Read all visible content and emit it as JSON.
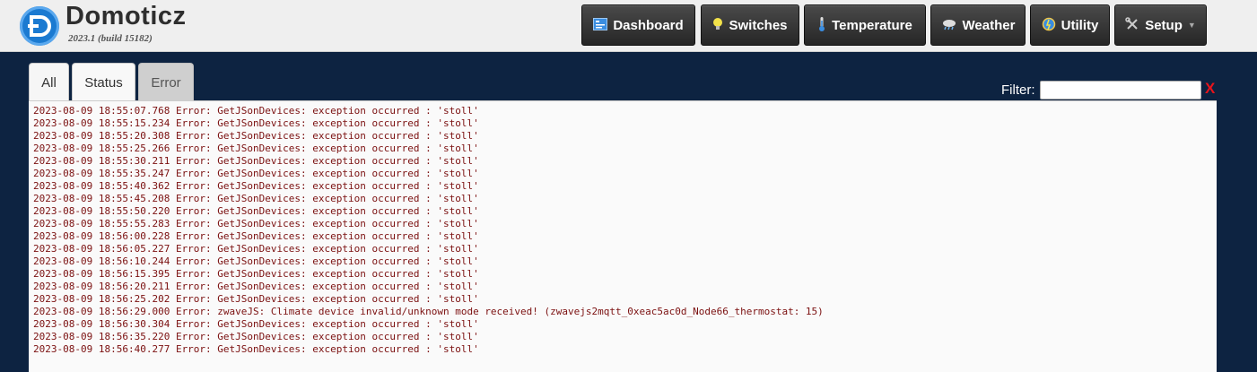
{
  "header": {
    "brand": "Domoticz",
    "version": "2023.1 (build 15182)"
  },
  "nav": [
    {
      "label": "Dashboard",
      "icon": "dashboard-icon"
    },
    {
      "label": "Switches",
      "icon": "lightbulb-icon"
    },
    {
      "label": "Temperature",
      "icon": "thermometer-icon"
    },
    {
      "label": "Weather",
      "icon": "weather-icon"
    },
    {
      "label": "Utility",
      "icon": "utility-icon"
    },
    {
      "label": "Setup",
      "icon": "tools-icon",
      "dropdown": true
    }
  ],
  "tabs": [
    {
      "label": "All"
    },
    {
      "label": "Status"
    },
    {
      "label": "Error"
    }
  ],
  "filter": {
    "label": "Filter:",
    "value": "",
    "clear": "X"
  },
  "colors": {
    "background": "#0d2341",
    "log_text": "#7b1010",
    "clear_icon": "#e8141b"
  },
  "log_lines": [
    "2023-08-09 18:55:07.768 Error: GetJSonDevices: exception occurred : 'stoll'",
    "2023-08-09 18:55:15.234 Error: GetJSonDevices: exception occurred : 'stoll'",
    "2023-08-09 18:55:20.308 Error: GetJSonDevices: exception occurred : 'stoll'",
    "2023-08-09 18:55:25.266 Error: GetJSonDevices: exception occurred : 'stoll'",
    "2023-08-09 18:55:30.211 Error: GetJSonDevices: exception occurred : 'stoll'",
    "2023-08-09 18:55:35.247 Error: GetJSonDevices: exception occurred : 'stoll'",
    "2023-08-09 18:55:40.362 Error: GetJSonDevices: exception occurred : 'stoll'",
    "2023-08-09 18:55:45.208 Error: GetJSonDevices: exception occurred : 'stoll'",
    "2023-08-09 18:55:50.220 Error: GetJSonDevices: exception occurred : 'stoll'",
    "2023-08-09 18:55:55.283 Error: GetJSonDevices: exception occurred : 'stoll'",
    "2023-08-09 18:56:00.228 Error: GetJSonDevices: exception occurred : 'stoll'",
    "2023-08-09 18:56:05.227 Error: GetJSonDevices: exception occurred : 'stoll'",
    "2023-08-09 18:56:10.244 Error: GetJSonDevices: exception occurred : 'stoll'",
    "2023-08-09 18:56:15.395 Error: GetJSonDevices: exception occurred : 'stoll'",
    "2023-08-09 18:56:20.211 Error: GetJSonDevices: exception occurred : 'stoll'",
    "2023-08-09 18:56:25.202 Error: GetJSonDevices: exception occurred : 'stoll'",
    "2023-08-09 18:56:29.000 Error: zwaveJS: Climate device invalid/unknown mode received! (zwavejs2mqtt_0xeac5ac0d_Node66_thermostat: 15)",
    "2023-08-09 18:56:30.304 Error: GetJSonDevices: exception occurred : 'stoll'",
    "2023-08-09 18:56:35.220 Error: GetJSonDevices: exception occurred : 'stoll'",
    "2023-08-09 18:56:40.277 Error: GetJSonDevices: exception occurred : 'stoll'"
  ]
}
